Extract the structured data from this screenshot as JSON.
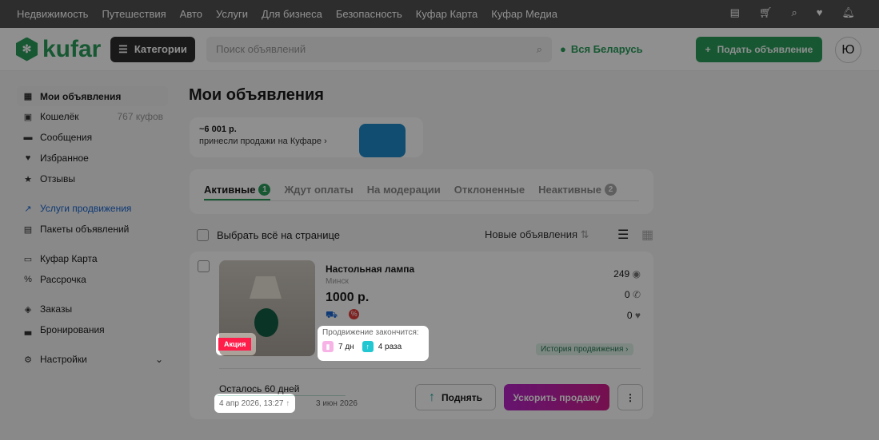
{
  "topnav": [
    "Недвижимость",
    "Путешествия",
    "Авто",
    "Услуги",
    "Для бизнеса",
    "Безопасность",
    "Куфар Карта",
    "Куфар Медиа"
  ],
  "header": {
    "logo": "kufar",
    "categories": "Категории",
    "search_placeholder": "Поиск объявлений",
    "region": "Вся Беларусь",
    "post": "Подать объявление",
    "avatar": "Ю"
  },
  "sidebar": [
    {
      "label": "Мои объявления",
      "icon": "grid"
    },
    {
      "label": "Кошелёк",
      "count": "767 куфов",
      "icon": "wallet"
    },
    {
      "label": "Сообщения",
      "icon": "chat"
    },
    {
      "label": "Избранное",
      "icon": "heart"
    },
    {
      "label": "Отзывы",
      "icon": "star"
    },
    {
      "label": "Услуги продвижения",
      "icon": "trend"
    },
    {
      "label": "Пакеты объявлений",
      "icon": "package"
    },
    {
      "label": "Куфар Карта",
      "icon": "card"
    },
    {
      "label": "Рассрочка",
      "icon": "percent"
    },
    {
      "label": "Заказы",
      "icon": "box"
    },
    {
      "label": "Бронирования",
      "icon": "bed"
    },
    {
      "label": "Настройки",
      "icon": "gear"
    }
  ],
  "main": {
    "title": "Мои объявления",
    "earnings": {
      "amount": "~6 001 р.",
      "text": "принесли продажи на Куфаре ›"
    },
    "tabs": [
      {
        "label": "Активные",
        "count": "1"
      },
      {
        "label": "Ждут оплаты"
      },
      {
        "label": "На модерации"
      },
      {
        "label": "Отклоненные"
      },
      {
        "label": "Неактивные",
        "count": "2"
      }
    ],
    "select_all": "Выбрать всё на странице",
    "sort": "Новые объявления",
    "listing": {
      "badge": "Акция",
      "title": "Настольная лампа",
      "city": "Минск",
      "price": "1000 р.",
      "views": "249",
      "calls": "0",
      "favorites": "0",
      "promo_label": "Продвижение закончится:",
      "promo_days": "7 дн",
      "promo_raises": "4 раза",
      "history": "История продвижения ›",
      "remaining": "Осталось 60 дней",
      "start": "4 апр 2026, 13:27",
      "end": "3 июн 2026",
      "raise": "Поднять",
      "boost": "Ускорить продажу"
    }
  }
}
